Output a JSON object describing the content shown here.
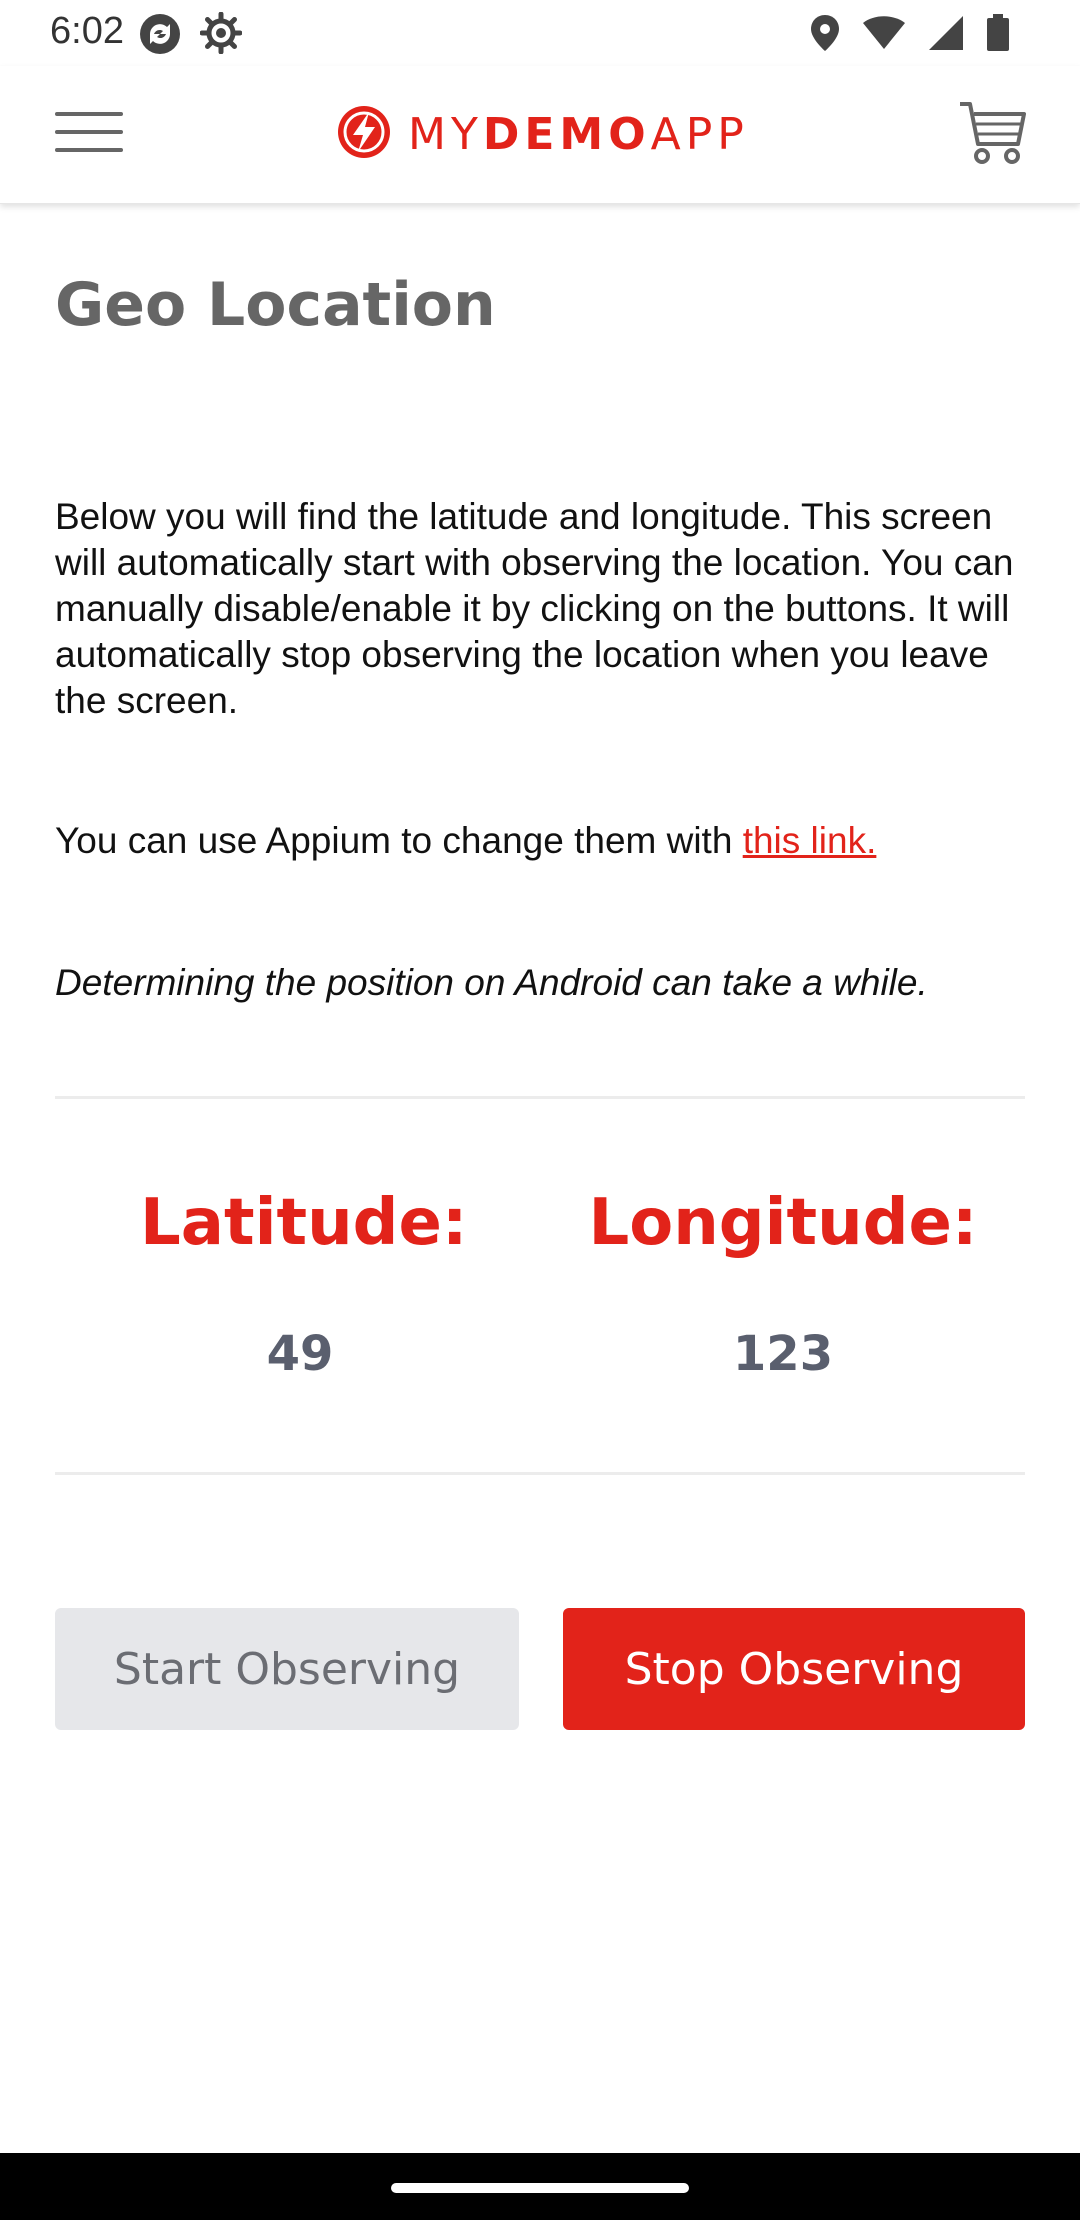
{
  "status_bar": {
    "time": "6:02",
    "left_icons": [
      "sync-icon",
      "settings-gear-icon"
    ],
    "right_icons": [
      "location-pin-icon",
      "wifi-icon",
      "signal-icon",
      "battery-icon"
    ]
  },
  "header": {
    "logo": {
      "text_regular_1": "MY",
      "text_bold": "DEMO",
      "text_regular_2": "APP",
      "brand_color": "#e2231a"
    },
    "menu_icon": "hamburger-menu-icon",
    "cart_icon": "cart-icon"
  },
  "page": {
    "title": "Geo Location",
    "description": "Below you will find the latitude and longitude. This screen will automatically start with observing the location. You can manually disable/enable it by clicking on the buttons. It will automatically stop observing the location when you leave the screen.",
    "appium_text": "You can use Appium to change them with ",
    "appium_link": "this link.",
    "note": "Determining the position on Android can take a while."
  },
  "coordinates": {
    "latitude_label": "Latitude:",
    "latitude_value": "49",
    "longitude_label": "Longitude:",
    "longitude_value": "123"
  },
  "buttons": {
    "start_label": "Start Observing",
    "stop_label": "Stop Observing"
  },
  "colors": {
    "accent": "#e2231a",
    "disabled_button": "#e6e7ea",
    "value_text": "#5a5f6e"
  }
}
